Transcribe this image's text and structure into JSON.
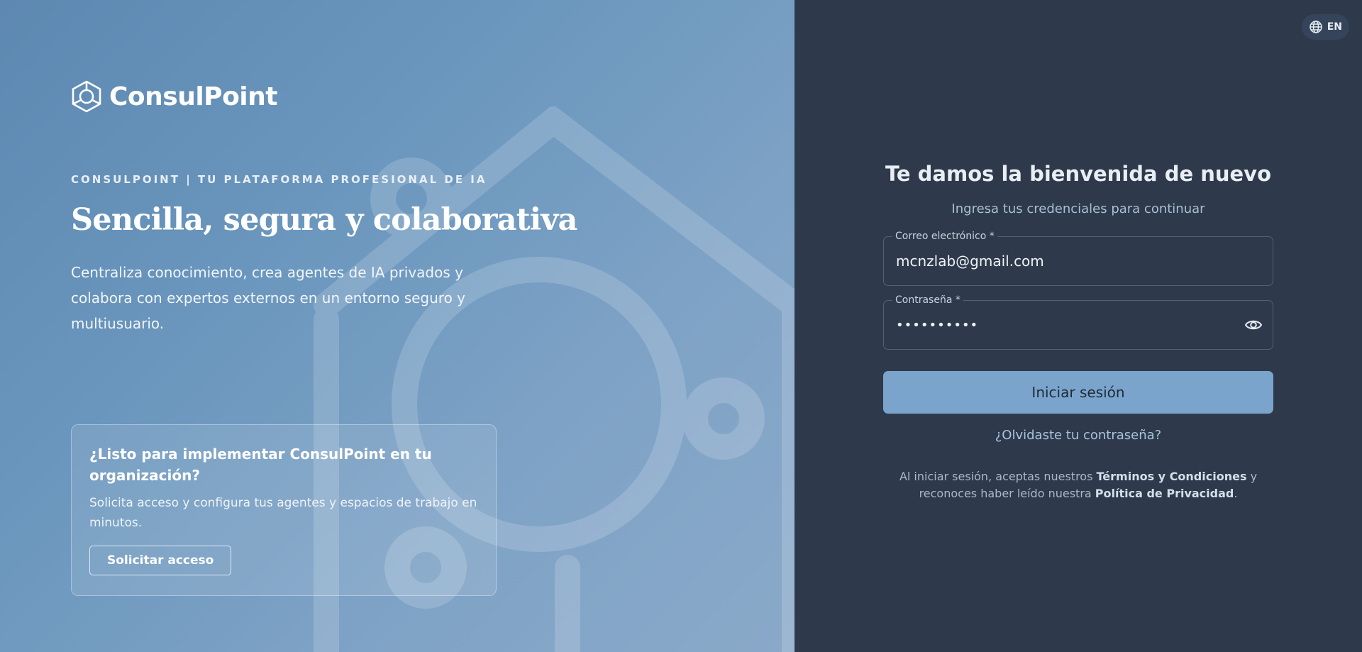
{
  "brand": {
    "name": "ConsulPoint"
  },
  "hero": {
    "eyebrow": "CONSULPOINT | TU PLATAFORMA PROFESIONAL DE IA",
    "headline": "Sencilla, segura y colaborativa",
    "intro": "Centraliza conocimiento, crea agentes de IA privados y colabora con expertos externos en un entorno seguro y multiusuario."
  },
  "cta": {
    "title": "¿Listo para implementar ConsulPoint en tu organización?",
    "description": "Solicita acceso y configura tus agentes y espacios de trabajo en minutos.",
    "button_label": "Solicitar acceso"
  },
  "language": {
    "code": "EN",
    "icon": "globe-icon"
  },
  "login": {
    "title": "Te damos la bienvenida de nuevo",
    "subtitle": "Ingresa tus credenciales para continuar",
    "email": {
      "label": "Correo electrónico *",
      "value": "mcnzlab@gmail.com"
    },
    "password": {
      "label": "Contraseña *",
      "masked_value": "••••••••••",
      "toggle_icon": "eye-icon"
    },
    "submit_label": "Iniciar sesión",
    "forgot_label": "¿Olvidaste tu contraseña?",
    "legal": {
      "prefix": "Al iniciar sesión, aceptas nuestros",
      "terms_link": "Términos y Condiciones",
      "middle": "y reconoces haber leído nuestra",
      "privacy_link": "Política de Privacidad",
      "suffix": "."
    }
  },
  "colors": {
    "left_panel": "#6a96bd",
    "right_panel": "#2e3a4b",
    "primary_button": "#7aa4cb",
    "link": "#a9c3de"
  }
}
